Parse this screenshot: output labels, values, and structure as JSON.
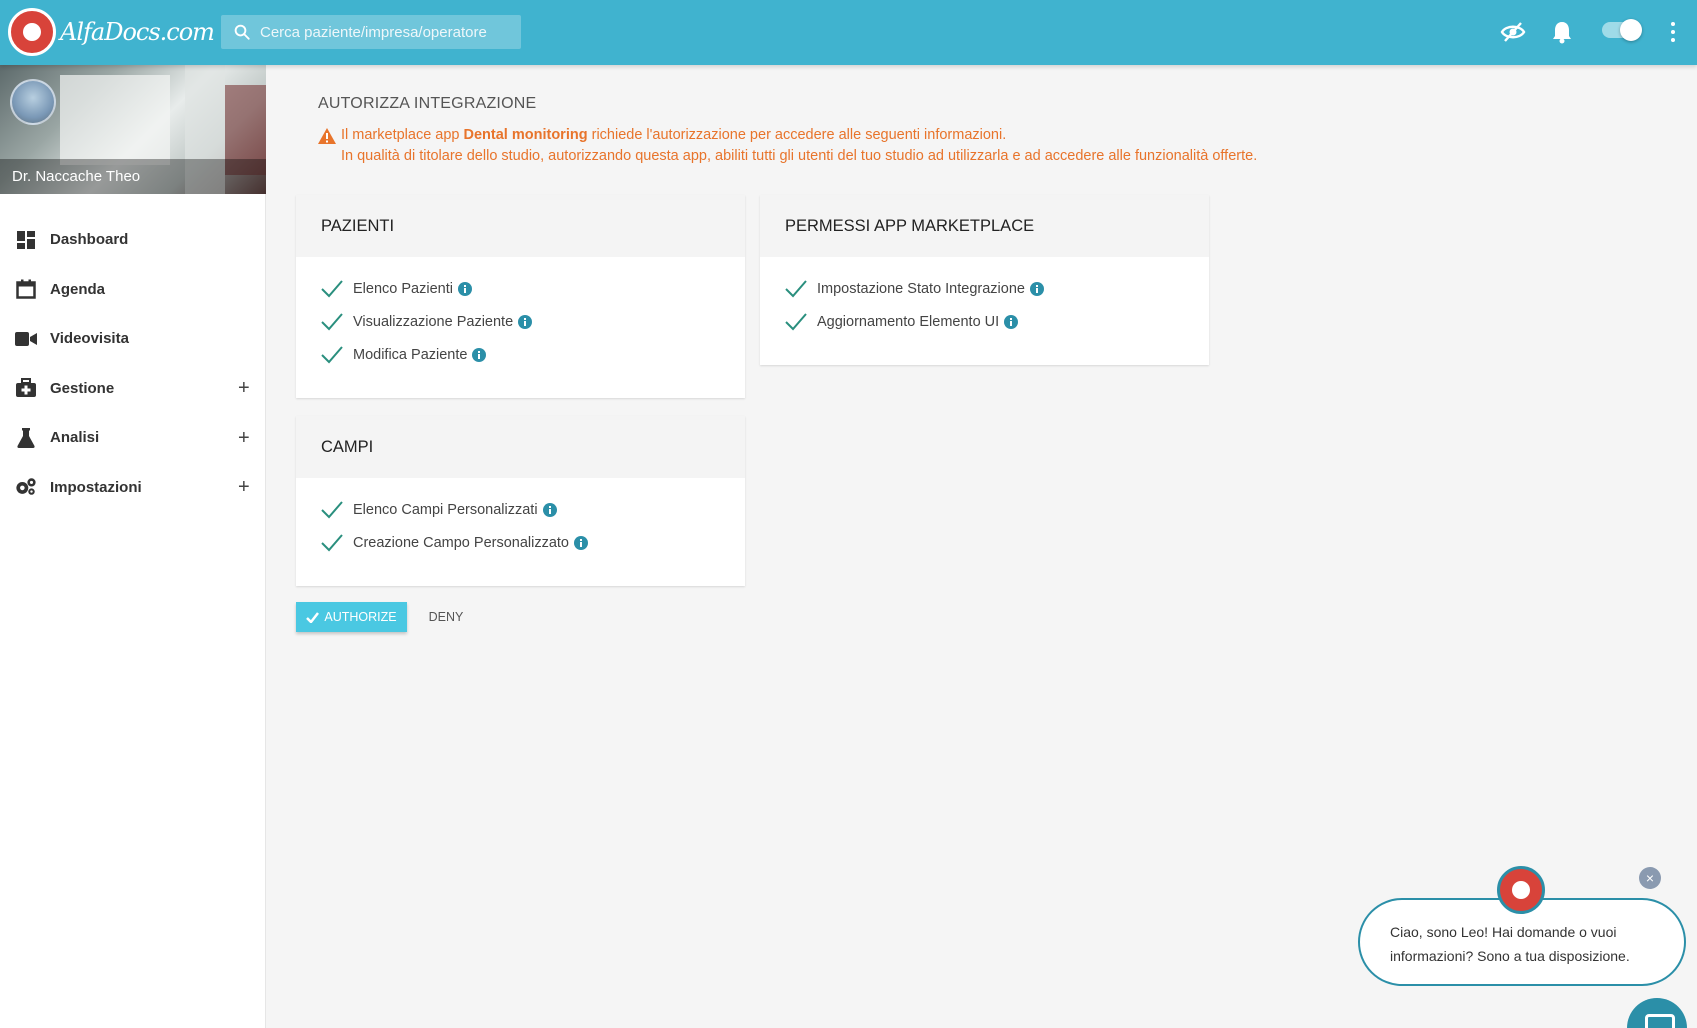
{
  "header": {
    "logo_text": "AlfaDocs.com",
    "search_placeholder": "Cerca paziente/impresa/operatore",
    "icons": [
      "eye-slash-icon",
      "bell-icon",
      "toggle-switch",
      "kebab-menu-icon"
    ]
  },
  "sidebar": {
    "profile_name": "Dr. Naccache Theo",
    "items": [
      {
        "label": "Dashboard",
        "icon": "dashboard-icon",
        "expandable": false
      },
      {
        "label": "Agenda",
        "icon": "calendar-icon",
        "expandable": false
      },
      {
        "label": "Videovisita",
        "icon": "video-camera-icon",
        "expandable": false
      },
      {
        "label": "Gestione",
        "icon": "medkit-icon",
        "expandable": true
      },
      {
        "label": "Analisi",
        "icon": "flask-icon",
        "expandable": true
      },
      {
        "label": "Impostazioni",
        "icon": "cogs-icon",
        "expandable": true
      }
    ],
    "expand_symbol": "+"
  },
  "main": {
    "title": "AUTORIZZA INTEGRAZIONE",
    "warning": {
      "prefix": "Il marketplace app",
      "app_name": "Dental monitoring",
      "suffix": "richiede l'autorizzazione per accedere alle seguenti informazioni.",
      "line2": "In qualità di titolare dello studio, autorizzando questa app, abiliti tutti gli utenti del tuo studio ad utilizzarla e ad accedere alle funzionalità offerte."
    },
    "cards": {
      "pazienti": {
        "title": "PAZIENTI",
        "items": [
          "Elenco Pazienti",
          "Visualizzazione Paziente",
          "Modifica Paziente"
        ]
      },
      "permessi": {
        "title": "PERMESSI APP MARKETPLACE",
        "items": [
          "Impostazione Stato Integrazione",
          "Aggiornamento Elemento UI"
        ]
      },
      "campi": {
        "title": "CAMPI",
        "items": [
          "Elenco Campi Personalizzati",
          "Creazione Campo Personalizzato"
        ]
      }
    },
    "buttons": {
      "authorize": "AUTHORIZE",
      "deny": "DENY"
    }
  },
  "chat": {
    "message": "Ciao, sono Leo! Hai domande o vuoi informazioni? Sono a tua disposizione.",
    "close_symbol": "×"
  },
  "colors": {
    "topbar": "#40b3cf",
    "accent": "#4ac8e2",
    "warning": "#e8742b",
    "check": "#2a8f7e",
    "info": "#2b8fa8"
  }
}
